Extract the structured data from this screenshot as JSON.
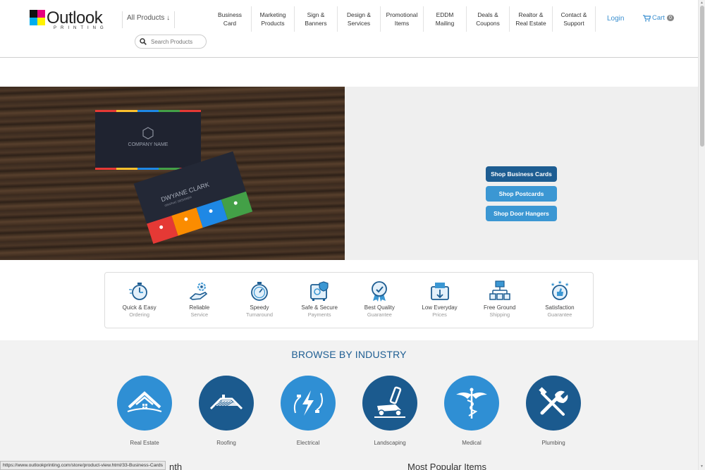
{
  "logo": {
    "word": "Outlook",
    "sub": "PRINTING",
    "colors": [
      "#111111",
      "#e6007e",
      "#00aeef",
      "#fff200"
    ]
  },
  "header": {
    "all_products": "All Products ↓",
    "search_placeholder": "Search Products",
    "nav": [
      {
        "l1": "Business",
        "l2": "Card"
      },
      {
        "l1": "Marketing",
        "l2": "Products"
      },
      {
        "l1": "Sign &",
        "l2": "Banners"
      },
      {
        "l1": "Design &",
        "l2": "Services"
      },
      {
        "l1": "Promotional",
        "l2": "Items"
      },
      {
        "l1": "EDDM",
        "l2": "Mailing"
      },
      {
        "l1": "Deals &",
        "l2": "Coupons"
      },
      {
        "l1": "Realtor &",
        "l2": "Real Estate"
      },
      {
        "l1": "Contact &",
        "l2": "Support"
      }
    ],
    "login": "Login",
    "cart": "Cart",
    "cart_count": "0"
  },
  "hero": {
    "card1_company": "COMPANY NAME",
    "card2_name": "DWYANE CLARK",
    "card2_role": "GRAPHIC DESIGNER",
    "buttons": [
      "Shop Business Cards",
      "Shop Postcards",
      "Shop Door Hangers"
    ]
  },
  "features": [
    {
      "title": "Quick & Easy",
      "sub": "Ordering",
      "icon": "stopwatch-icon"
    },
    {
      "title": "Reliable",
      "sub": "Service",
      "icon": "hand-gear-icon"
    },
    {
      "title": "Speedy",
      "sub": "Turnaround",
      "icon": "timer-icon"
    },
    {
      "title": "Safe & Secure",
      "sub": "Payments",
      "icon": "safe-icon"
    },
    {
      "title": "Best Quality",
      "sub": "Guarantee",
      "icon": "medal-icon"
    },
    {
      "title": "Low Everyday",
      "sub": "Prices",
      "icon": "wallet-icon"
    },
    {
      "title": "Free Ground",
      "sub": "Shipping",
      "icon": "truck-network-icon"
    },
    {
      "title": "Satisfaction",
      "sub": "Guarantee",
      "icon": "thumbs-up-stars-icon"
    }
  ],
  "industry": {
    "title": "BROWSE BY INDUSTRY",
    "items": [
      {
        "label": "Real Estate",
        "icon": "house-icon",
        "color": "#2f8fd4"
      },
      {
        "label": "Roofing",
        "icon": "roof-icon",
        "color": "#1b5a8e"
      },
      {
        "label": "Electrical",
        "icon": "lightning-plug-icon",
        "color": "#2f8fd4"
      },
      {
        "label": "Landscaping",
        "icon": "lawn-mower-icon",
        "color": "#1b5a8e"
      },
      {
        "label": "Medical",
        "icon": "caduceus-icon",
        "color": "#2f8fd4"
      },
      {
        "label": "Plumbing",
        "icon": "wrench-icon",
        "color": "#1b5a8e"
      }
    ]
  },
  "bottom": {
    "left_heading": "nth",
    "right_heading": "Most Popular Items"
  },
  "status_bar": "https://www.outlookprinting.com/store/product-view.html/33-Business-Cards"
}
